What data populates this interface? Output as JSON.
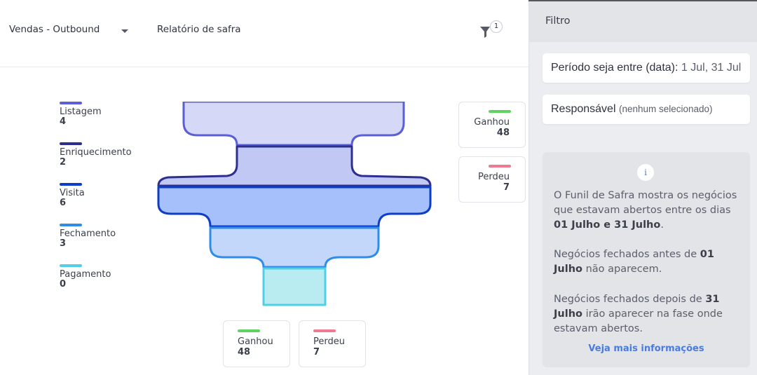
{
  "header": {
    "pipeline": "Vendas - Outbound",
    "report": "Relatório de safra",
    "filter_count": "1"
  },
  "colors": {
    "stage_listagem": "#5b5fd6",
    "stage_enriquecimento": "#2d2f8f",
    "stage_visita": "#0d3ec7",
    "stage_fechamento": "#2f8de8",
    "stage_pagamento": "#4fd0e6",
    "won": "#5fd35f",
    "lost": "#ee7a90",
    "link": "#4a7be0"
  },
  "legend": [
    {
      "label": "Listagem",
      "count": "4"
    },
    {
      "label": "Enriquecimento",
      "count": "2"
    },
    {
      "label": "Visita",
      "count": "6"
    },
    {
      "label": "Fechamento",
      "count": "3"
    },
    {
      "label": "Pagamento",
      "count": "0"
    }
  ],
  "side_result": {
    "won_label": "Ganhou",
    "won_value": "48",
    "lost_label": "Perdeu",
    "lost_value": "7"
  },
  "bottom_result": {
    "won_label": "Ganhou",
    "won_value": "48",
    "lost_label": "Perdeu",
    "lost_value": "7"
  },
  "sidebar": {
    "title": "Filtro",
    "filters": [
      {
        "label": "Período seja entre (data):",
        "value": "1 Jul, 31 Jul"
      },
      {
        "label": "Responsável",
        "value": "(nenhum selecionado)"
      }
    ],
    "info": {
      "icon": "info-icon",
      "p1_a": "O Funil de Safra mostra os negócios que estavam abertos entre os dias ",
      "p1_b": "01 Julho e 31 Julho",
      "p1_c": ".",
      "p2_a": "Negócios fechados antes de ",
      "p2_b": "01 Julho",
      "p2_c": " não aparecem.",
      "p3_a": "Negócios fechados depois de ",
      "p3_b": "31 Julho",
      "p3_c": " irão aparecer na fase onde estavam abertos.",
      "link": "Veja mais informações"
    }
  }
}
